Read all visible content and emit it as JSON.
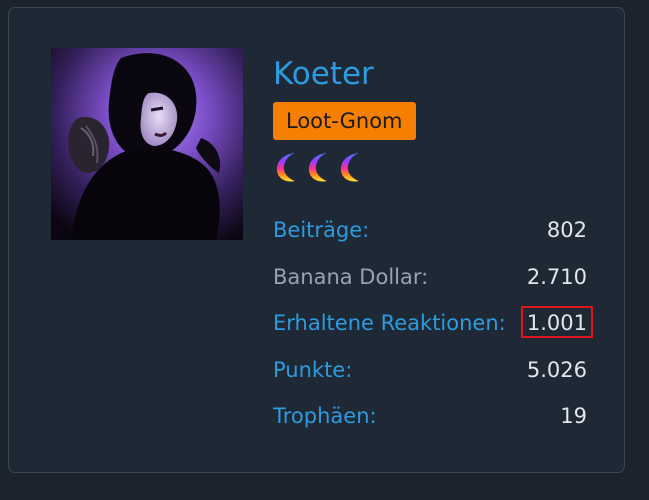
{
  "profile": {
    "username": "Koeter",
    "rank_badge": "Loot-Gnom",
    "trophy_icons": [
      "moon-icon",
      "moon-icon",
      "moon-icon"
    ],
    "avatar_icon": "avatar-image",
    "colors": {
      "link_blue": "#2d9be0",
      "badge_orange": "#f77f00",
      "highlight_red": "#e0121c"
    }
  },
  "stats": [
    {
      "label": "Beiträge",
      "separator": ":",
      "value": "802"
    },
    {
      "label": "Banana Dollar:",
      "value": "2.710"
    },
    {
      "label": "Erhaltene Reaktionen",
      "separator": ":",
      "value": "1.001"
    },
    {
      "label": "Punkte",
      "separator": ":",
      "value": "5.026"
    },
    {
      "label": "Trophäen",
      "separator": ":",
      "value": "19"
    }
  ]
}
